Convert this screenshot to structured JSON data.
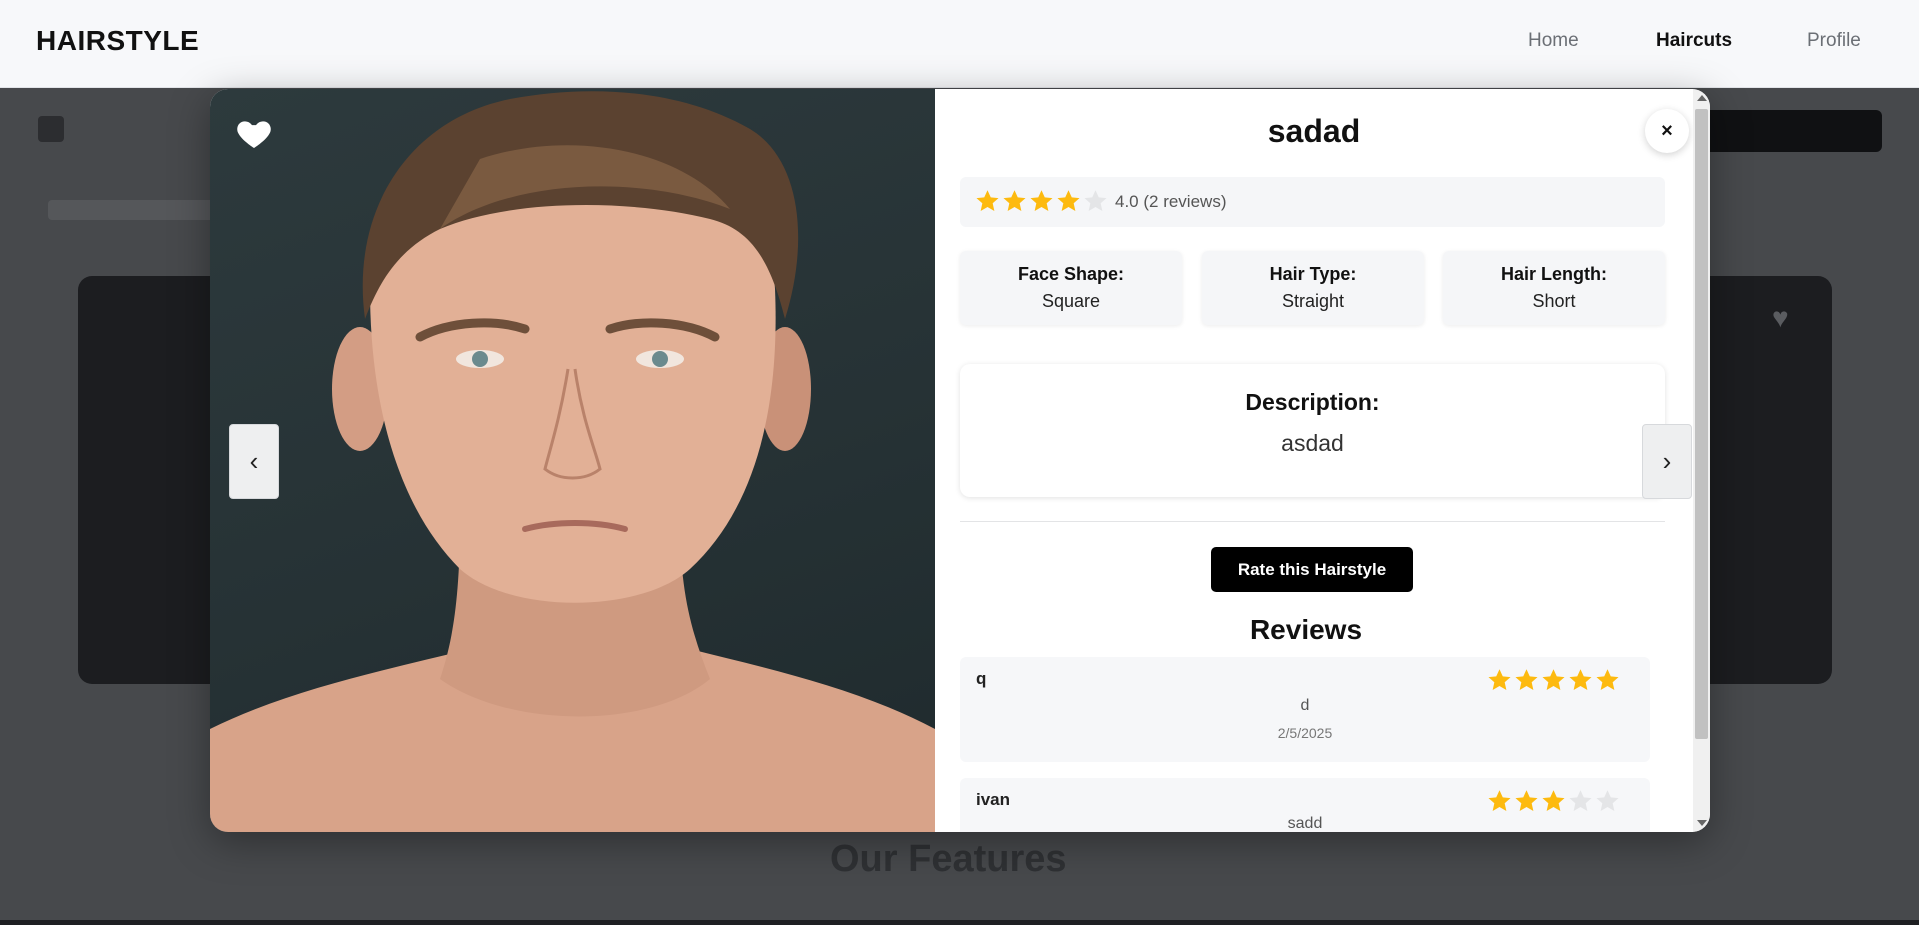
{
  "navbar": {
    "brand": "HAIRSTYLE",
    "links": [
      {
        "label": "Home",
        "active": false
      },
      {
        "label": "Haircuts",
        "active": true
      },
      {
        "label": "Profile",
        "active": false
      }
    ]
  },
  "background": {
    "section_title": "Our Features"
  },
  "modal": {
    "favorite_icon": "heart-icon",
    "prev_label": "‹",
    "next_label": "›",
    "close_label": "×",
    "title": "sadad",
    "rating": {
      "stars_filled": 4,
      "stars_total": 5,
      "text": "4.0 (2 reviews)"
    },
    "attributes": [
      {
        "label": "Face Shape:",
        "value": "Square"
      },
      {
        "label": "Hair Type:",
        "value": "Straight"
      },
      {
        "label": "Hair Length:",
        "value": "Short"
      }
    ],
    "description": {
      "label": "Description:",
      "value": "asdad"
    },
    "rate_button_label": "Rate this Hairstyle",
    "reviews_title": "Reviews",
    "reviews": [
      {
        "user": "q",
        "stars": 5,
        "comment": "d",
        "date": "2/5/2025"
      },
      {
        "user": "ivan",
        "stars": 3,
        "comment": "sadd",
        "date": ""
      }
    ],
    "colors": {
      "star_filled": "#FDBA0F",
      "star_empty": "#E4E5E7",
      "button_bg": "#000000"
    }
  }
}
